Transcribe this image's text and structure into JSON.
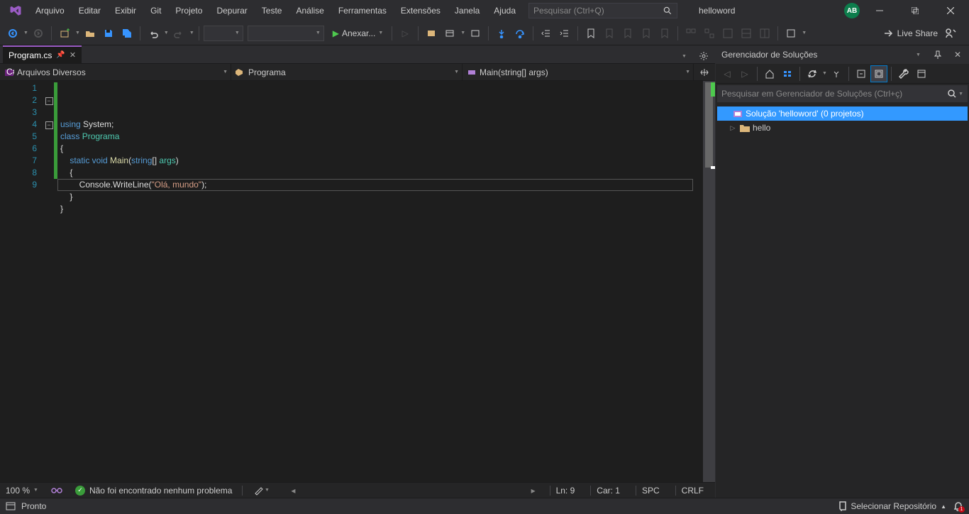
{
  "menubar": {
    "items": [
      "Arquivo",
      "Editar",
      "Exibir",
      "Git",
      "Projeto",
      "Depurar",
      "Teste",
      "Análise",
      "Ferramentas",
      "Extensões",
      "Janela",
      "Ajuda"
    ],
    "search_placeholder": "Pesquisar (Ctrl+Q)",
    "solution_name": "helloword",
    "avatar": "AB"
  },
  "toolbar": {
    "start_label": "Anexar...",
    "live_share": "Live Share"
  },
  "tab": {
    "name": "Program.cs"
  },
  "navbar": {
    "project": "Arquivos Diversos",
    "class": "Programa",
    "member": "Main(string[] args)"
  },
  "code": {
    "line_numbers": [
      "1",
      "2",
      "3",
      "4",
      "5",
      "6",
      "7",
      "8",
      "9"
    ],
    "tokens": [
      [
        {
          "t": "using ",
          "c": "kw"
        },
        {
          "t": "System;",
          "c": ""
        }
      ],
      [
        {
          "t": "class ",
          "c": "kw"
        },
        {
          "t": "Programa",
          "c": "cls"
        }
      ],
      [
        {
          "t": "{",
          "c": ""
        }
      ],
      [
        {
          "t": "    ",
          "c": ""
        },
        {
          "t": "static void ",
          "c": "kw"
        },
        {
          "t": "Main",
          "c": "mth"
        },
        {
          "t": "(",
          "c": ""
        },
        {
          "t": "string",
          "c": "kw"
        },
        {
          "t": "[] ",
          "c": ""
        },
        {
          "t": "args",
          "c": "cls"
        },
        {
          "t": ")",
          "c": ""
        }
      ],
      [
        {
          "t": "    {",
          "c": ""
        }
      ],
      [
        {
          "t": "        Console.WriteLine(",
          "c": ""
        },
        {
          "t": "\"Olá, mundo\"",
          "c": "str"
        },
        {
          "t": ");",
          "c": ""
        }
      ],
      [
        {
          "t": "    }",
          "c": ""
        }
      ],
      [
        {
          "t": "}",
          "c": ""
        }
      ],
      [
        {
          "t": "",
          "c": ""
        }
      ]
    ]
  },
  "editor_status": {
    "zoom": "100 %",
    "issues": "Não foi encontrado nenhum problema",
    "ln": "Ln: 9",
    "car": "Car: 1",
    "enc": "SPC",
    "eol": "CRLF"
  },
  "solution_explorer": {
    "title": "Gerenciador de Soluções",
    "search_placeholder": "Pesquisar em Gerenciador de Soluções (Ctrl+ç)",
    "root": "Solução 'helloword' (0 projetos)",
    "items": [
      "hello"
    ]
  },
  "statusbar": {
    "ready": "Pronto",
    "repo": "Selecionar Repositório",
    "notif": "1"
  }
}
